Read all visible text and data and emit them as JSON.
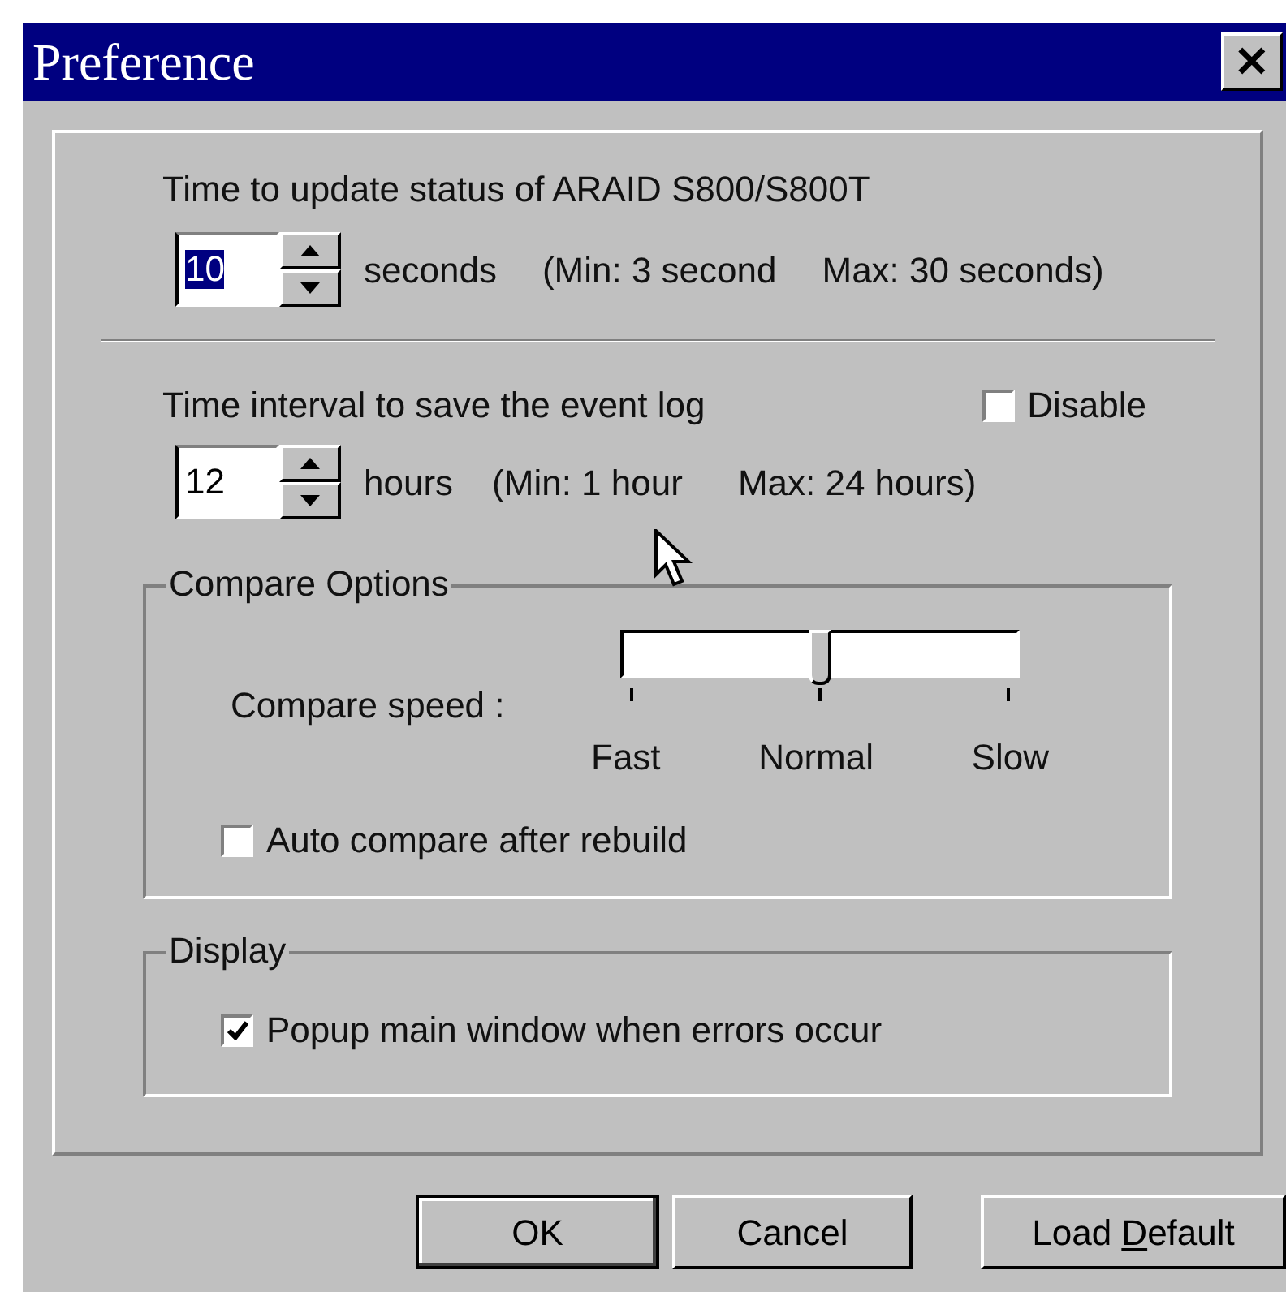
{
  "window": {
    "title": "Preference",
    "close_label": "✕"
  },
  "update": {
    "label": "Time to update status of ARAID S800/S800T",
    "value": "10",
    "value_selected": true,
    "unit": "seconds",
    "min": "(Min: 3 second",
    "max": "Max: 30 seconds)"
  },
  "event_log": {
    "label": "Time interval to save the event log",
    "disable": {
      "label": "Disable",
      "checked": false
    },
    "value": "12",
    "value_selected": false,
    "unit": "hours",
    "min": "(Min: 1 hour",
    "max": "Max: 24 hours)"
  },
  "compare_options": {
    "legend": "Compare Options",
    "speed_label": "Compare speed :",
    "speed": {
      "level": 0.5,
      "ticks": [
        "Fast",
        "Normal",
        "Slow"
      ]
    },
    "auto_compare": {
      "label": "Auto compare after rebuild",
      "checked": false
    }
  },
  "display": {
    "legend": "Display",
    "popup": {
      "label": "Popup main window when errors occur",
      "checked": true
    }
  },
  "buttons": [
    {
      "label": "OK",
      "default": true
    },
    {
      "label": "Cancel",
      "default": false
    },
    {
      "label_before": "Load ",
      "access_key": "D",
      "label_after": "efault",
      "default": false
    }
  ]
}
